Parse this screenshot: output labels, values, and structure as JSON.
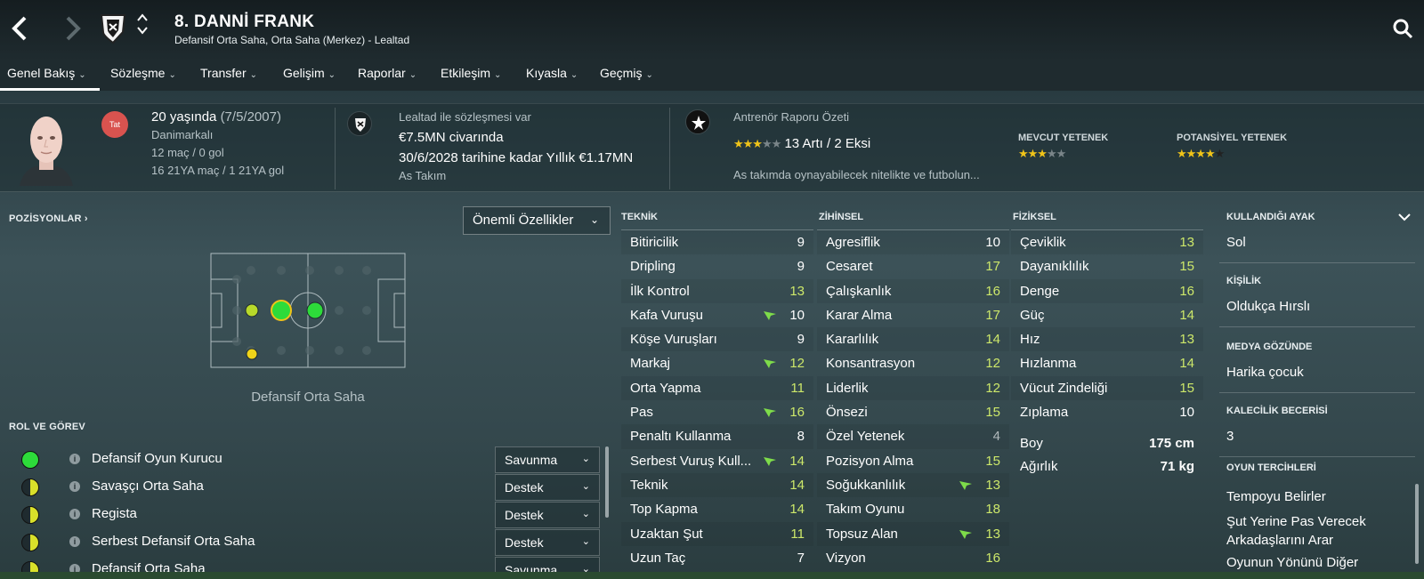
{
  "header": {
    "player_name": "8. DANNİ FRANK",
    "player_sub": "Defansif Orta Saha, Orta Saha (Merkez) - Lealtad",
    "up_arrow": "⌃",
    "down_arrow": "⌄"
  },
  "menu": [
    {
      "label": "Genel Bakış"
    },
    {
      "label": "Sözleşme"
    },
    {
      "label": "Transfer"
    },
    {
      "label": "Gelişim"
    },
    {
      "label": "Raporlar"
    },
    {
      "label": "Etkileşim"
    },
    {
      "label": "Kıyasla"
    },
    {
      "label": "Geçmiş"
    }
  ],
  "info": {
    "personality_badge": "Tat",
    "age": "20 yaşında",
    "dob": "(7/5/2007)",
    "nationality": "Danimarkalı",
    "caps": "12 maç / 0 gol",
    "u21": "16 21YA maç / 1 21YA gol",
    "contract_club": "Lealtad ile sözleşmesi var",
    "value": "€7.5MN civarında",
    "contract_until": "30/6/2028 tarihine kadar Yıllık €1.17MN",
    "squad": "As Takım",
    "coach_report_title": "Antrenör Raporu Özeti",
    "report_stars": 3,
    "report_summary": "13 Artı / 2 Eksi",
    "report_text": "As takımda oynayabilecek nitelikte ve futbolun...",
    "current_ability_label": "MEVCUT YETENEK",
    "current_ability_stars": 3,
    "potential_ability_label": "POTANSİYEL YETENEK",
    "potential_ability_stars": 4,
    "star_color": "#f0c419"
  },
  "positions": {
    "title": "POZİSYONLAR",
    "dropdown": "Önemli Özellikler",
    "caption": "Defansif Orta Saha"
  },
  "roles": {
    "title": "ROL VE GÖREV",
    "items": [
      {
        "name": "Defansif Oyun Kurucu",
        "duty": "Savunma",
        "rating": "full"
      },
      {
        "name": "Savaşçı Orta Saha",
        "duty": "Destek",
        "rating": "half"
      },
      {
        "name": "Regista",
        "duty": "Destek",
        "rating": "half"
      },
      {
        "name": "Serbest Defansif Orta Saha",
        "duty": "Destek",
        "rating": "half"
      },
      {
        "name": "Defansif Orta Saha",
        "duty": "Savunma",
        "rating": "half"
      }
    ]
  },
  "attributes": {
    "technical_title": "TEKNİK",
    "mental_title": "ZİHİNSEL",
    "physical_title": "FİZİKSEL",
    "technical": [
      {
        "name": "Bitiricilik",
        "value": "9",
        "arrow": false
      },
      {
        "name": "Dripling",
        "value": "9",
        "arrow": false
      },
      {
        "name": "İlk Kontrol",
        "value": "13",
        "arrow": false
      },
      {
        "name": "Kafa Vuruşu",
        "value": "10",
        "arrow": true
      },
      {
        "name": "Köşe Vuruşları",
        "value": "9",
        "arrow": false
      },
      {
        "name": "Markaj",
        "value": "12",
        "arrow": true
      },
      {
        "name": "Orta Yapma",
        "value": "11",
        "arrow": false
      },
      {
        "name": "Pas",
        "value": "16",
        "arrow": true
      },
      {
        "name": "Penaltı Kullanma",
        "value": "8",
        "arrow": false
      },
      {
        "name": "Serbest Vuruş Kull...",
        "value": "14",
        "arrow": true
      },
      {
        "name": "Teknik",
        "value": "14",
        "arrow": false
      },
      {
        "name": "Top Kapma",
        "value": "14",
        "arrow": false
      },
      {
        "name": "Uzaktan Şut",
        "value": "11",
        "arrow": false
      },
      {
        "name": "Uzun Taç",
        "value": "7",
        "arrow": false
      }
    ],
    "mental": [
      {
        "name": "Agresiflik",
        "value": "10",
        "arrow": false
      },
      {
        "name": "Cesaret",
        "value": "17",
        "arrow": false
      },
      {
        "name": "Çalışkanlık",
        "value": "16",
        "arrow": false
      },
      {
        "name": "Karar Alma",
        "value": "17",
        "arrow": false
      },
      {
        "name": "Kararlılık",
        "value": "14",
        "arrow": false
      },
      {
        "name": "Konsantrasyon",
        "value": "12",
        "arrow": false
      },
      {
        "name": "Liderlik",
        "value": "12",
        "arrow": false
      },
      {
        "name": "Önsezi",
        "value": "15",
        "arrow": false
      },
      {
        "name": "Özel Yetenek",
        "value": "4",
        "arrow": false
      },
      {
        "name": "Pozisyon Alma",
        "value": "15",
        "arrow": false
      },
      {
        "name": "Soğukkanlılık",
        "value": "13",
        "arrow": true
      },
      {
        "name": "Takım Oyunu",
        "value": "18",
        "arrow": false
      },
      {
        "name": "Topsuz Alan",
        "value": "13",
        "arrow": true
      },
      {
        "name": "Vizyon",
        "value": "16",
        "arrow": false
      }
    ],
    "physical": [
      {
        "name": "Çeviklik",
        "value": "13",
        "arrow": false
      },
      {
        "name": "Dayanıklılık",
        "value": "15",
        "arrow": false
      },
      {
        "name": "Denge",
        "value": "16",
        "arrow": false
      },
      {
        "name": "Güç",
        "value": "14",
        "arrow": false
      },
      {
        "name": "Hız",
        "value": "13",
        "arrow": false
      },
      {
        "name": "Hızlanma",
        "value": "14",
        "arrow": false
      },
      {
        "name": "Vücut Zindeliği",
        "value": "15",
        "arrow": false
      },
      {
        "name": "Zıplama",
        "value": "10",
        "arrow": false
      }
    ],
    "height_label": "Boy",
    "height_value": "175 cm",
    "weight_label": "Ağırlık",
    "weight_value": "71 kg"
  },
  "right_panel": {
    "foot_title": "KULLANDIĞI AYAK",
    "foot_value": "Sol",
    "personality_title": "KİŞİLİK",
    "personality_value": "Oldukça Hırslı",
    "media_title": "MEDYA GÖZÜNDE",
    "media_value": "Harika çocuk",
    "gk_title": "KALECİLİK BECERİSİ",
    "gk_value": "3",
    "prefs_title": "OYUN TERCİHLERİ",
    "prefs": [
      "Tempoyu Belirler",
      "Şut Yerine Pas Verecek Arkadaşlarını Arar",
      "Oyunun Yönünü Diğer"
    ]
  }
}
